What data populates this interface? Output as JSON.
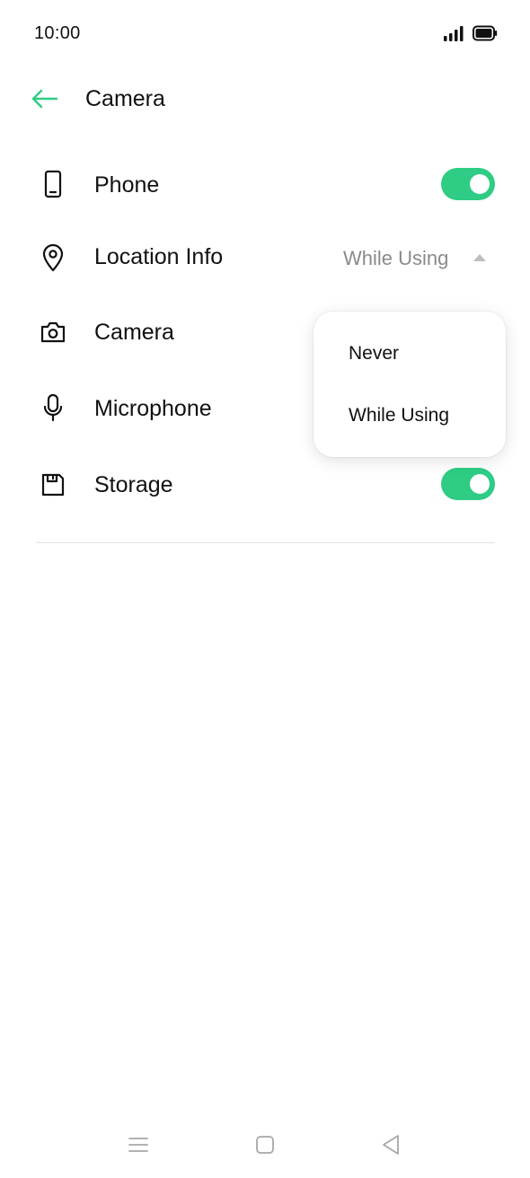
{
  "status_bar": {
    "time": "10:00",
    "signal_icon": "signal-bars-icon",
    "battery_icon": "battery-full-icon"
  },
  "header": {
    "back_icon": "arrow-left-icon",
    "title": "Camera",
    "accent_color": "#2ecc84"
  },
  "permissions": [
    {
      "icon": "phone-icon",
      "label": "Phone",
      "control": "toggle",
      "on": true
    },
    {
      "icon": "location-pin-icon",
      "label": "Location Info",
      "control": "select",
      "value": "While Using"
    },
    {
      "icon": "camera-icon",
      "label": "Camera"
    },
    {
      "icon": "microphone-icon",
      "label": "Microphone"
    },
    {
      "icon": "storage-save-icon",
      "label": "Storage",
      "control": "toggle",
      "on": true
    }
  ],
  "dropdown": {
    "options": [
      "Never",
      "While Using"
    ]
  },
  "nav_bar": {
    "menu_icon": "menu-icon",
    "home_icon": "home-square-icon",
    "back_icon": "back-triangle-icon"
  }
}
